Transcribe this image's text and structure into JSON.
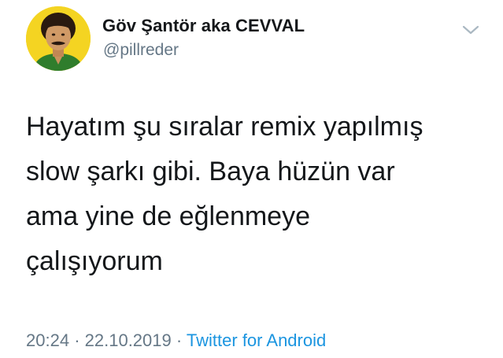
{
  "tweet": {
    "author": {
      "display_name": "Göv Şantör aka CEVVAL",
      "handle": "@pillreder",
      "avatar_icon": "profile-photo"
    },
    "menu_icon": "chevron-down-icon",
    "text_lines": [
      "Hayatım şu sıralar remix yapılmış",
      "slow şarkı gibi. Baya hüzün var",
      "ama yine de eğlenmeye",
      "çalışıyorum"
    ],
    "time": "20:24",
    "separator": "·",
    "date": "22.10.2019",
    "source": "Twitter for Android"
  },
  "colors": {
    "text_primary": "#14171a",
    "text_secondary": "#657786",
    "link": "#1b95e0",
    "chevron": "#aab8c2"
  }
}
